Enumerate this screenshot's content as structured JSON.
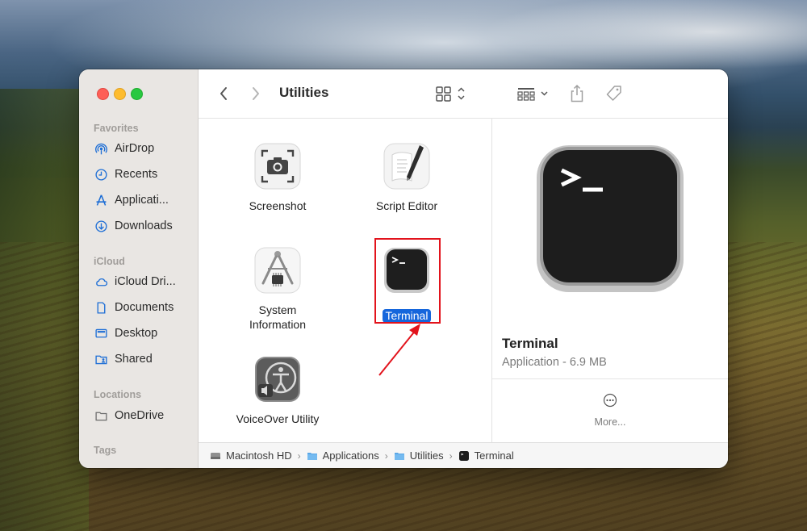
{
  "window": {
    "title": "Utilities"
  },
  "sidebar": {
    "favorites_title": "Favorites",
    "favorites": [
      {
        "label": "AirDrop",
        "icon": "airdrop-icon"
      },
      {
        "label": "Recents",
        "icon": "clock-icon"
      },
      {
        "label": "Applicati...",
        "icon": "applications-icon"
      },
      {
        "label": "Downloads",
        "icon": "download-icon"
      }
    ],
    "icloud_title": "iCloud",
    "icloud": [
      {
        "label": "iCloud Dri...",
        "icon": "cloud-icon"
      },
      {
        "label": "Documents",
        "icon": "document-icon"
      },
      {
        "label": "Desktop",
        "icon": "desktop-icon"
      },
      {
        "label": "Shared",
        "icon": "shared-folder-icon"
      }
    ],
    "locations_title": "Locations",
    "locations": [
      {
        "label": "OneDrive",
        "icon": "folder-icon"
      }
    ],
    "tags_title": "Tags"
  },
  "files": [
    {
      "label": "Screenshot",
      "icon": "screenshot-app-icon"
    },
    {
      "label": "Script Editor",
      "icon": "script-editor-app-icon"
    },
    {
      "label": "System\nInformation",
      "icon": "system-information-app-icon"
    },
    {
      "label": "Terminal",
      "icon": "terminal-app-icon",
      "selected": true
    },
    {
      "label": "VoiceOver Utility",
      "icon": "voiceover-utility-app-icon"
    }
  ],
  "preview": {
    "name": "Terminal",
    "kind_size": "Application - 6.9 MB",
    "more_label": "More..."
  },
  "pathbar": [
    {
      "label": "Macintosh HD",
      "icon": "hard-drive-icon"
    },
    {
      "label": "Applications",
      "icon": "folder-icon"
    },
    {
      "label": "Utilities",
      "icon": "folder-icon"
    },
    {
      "label": "Terminal",
      "icon": "terminal-icon"
    }
  ],
  "colors": {
    "selection": "#1566dc",
    "highlight_box": "#e2131c",
    "sidebar_bg": "#e9e6e3",
    "sidebar_icon": "#1f6fd6"
  }
}
